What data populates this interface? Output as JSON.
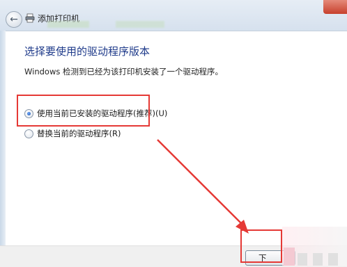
{
  "window": {
    "title": "添加打印机"
  },
  "page": {
    "heading": "选择要使用的驱动程序版本",
    "description": "Windows 检测到已经为该打印机安装了一个驱动程序。"
  },
  "options": [
    {
      "label": "使用当前已安装的驱动程序(推荐)(U)",
      "checked": true
    },
    {
      "label": "替换当前的驱动程序(R)",
      "checked": false
    }
  ],
  "footer": {
    "next_label": "下"
  },
  "colors": {
    "annotation": "#e53935",
    "heading": "#1e3a8a"
  },
  "icons": {
    "back": "back-arrow-icon",
    "printer": "printer-icon"
  }
}
